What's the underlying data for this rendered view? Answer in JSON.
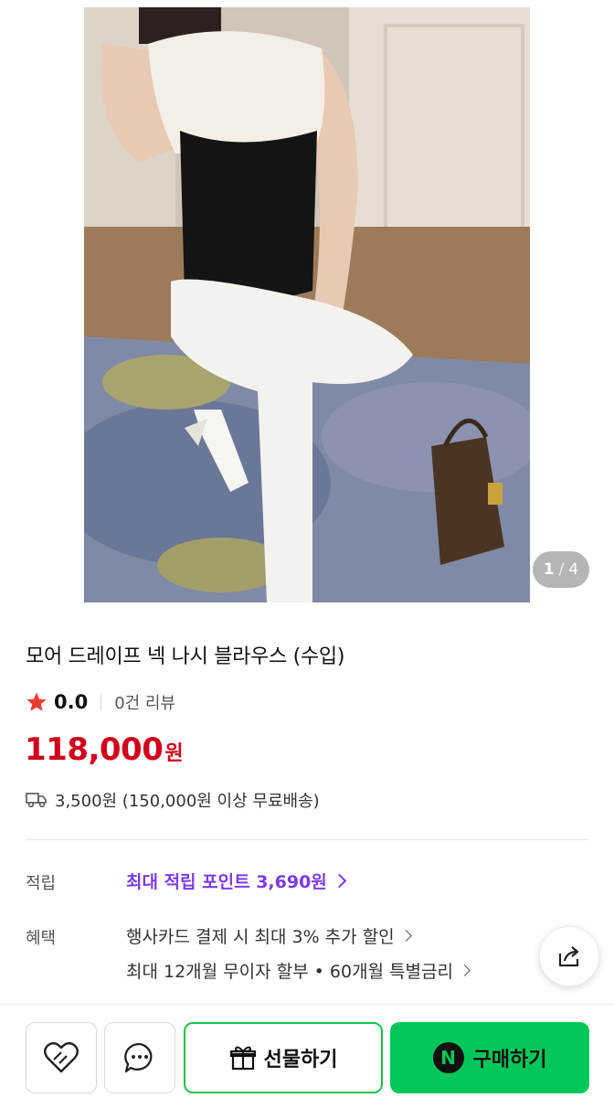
{
  "gallery": {
    "current": "1",
    "separator": "/",
    "total": "4"
  },
  "product": {
    "title": "모어 드레이프 넥 나시 블라우스 (수입)",
    "rating": "0.0",
    "review_count": "0건 리뷰",
    "price": "118,000",
    "price_unit": "원",
    "shipping": "3,500원 (150,000원 이상 무료배송)"
  },
  "benefits": {
    "points_label": "적립",
    "points_text": "최대 적립 포인트 3,690원",
    "benefit_label": "혜택",
    "benefit_1": "행사카드 결제 시 최대 3% 추가 할인",
    "benefit_2": "최대 12개월 무이자 할부 • 60개월 특별금리"
  },
  "bottom_bar": {
    "gift_label": "선물하기",
    "buy_label": "구매하기",
    "buy_badge": "N"
  },
  "colors": {
    "price": "#d0021b",
    "points": "#7c3aed",
    "buy": "#03c75a",
    "star": "#ef3b2d"
  },
  "icons": [
    "star-icon",
    "truck-icon",
    "share-icon",
    "heart-icon",
    "chat-icon",
    "gift-icon",
    "naver-n-icon"
  ]
}
